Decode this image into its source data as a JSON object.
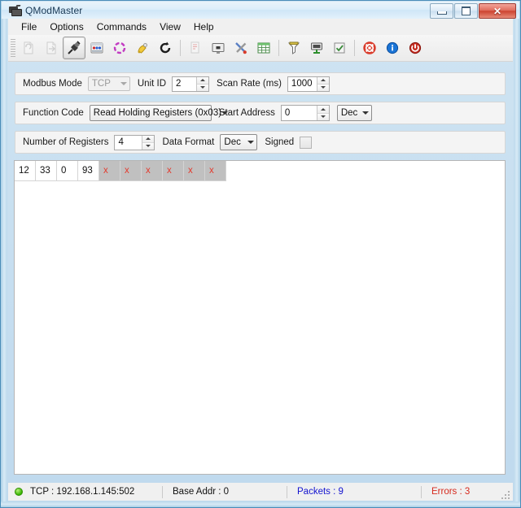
{
  "window": {
    "title": "QModMaster",
    "icon": "modbus-app-icon",
    "buttons": {
      "minimize": "minimize-button",
      "maximize": "maximize-button",
      "close": "close-button",
      "close_glyph": "✕"
    }
  },
  "menu": {
    "items": [
      {
        "label": "File"
      },
      {
        "label": "Options"
      },
      {
        "label": "Commands"
      },
      {
        "label": "View"
      },
      {
        "label": "Help"
      }
    ]
  },
  "toolbar": {
    "buttons": [
      {
        "name": "new-icon",
        "title": "New",
        "disabled": true
      },
      {
        "name": "open-icon",
        "title": "Open",
        "disabled": true
      },
      {
        "name": "connect-plug-icon",
        "title": "Connect",
        "active": true
      },
      {
        "name": "modbus-settings-icon",
        "title": "Modbus RTU/TCP Settings"
      },
      {
        "name": "scan-loop-icon",
        "title": "Scan"
      },
      {
        "name": "bell-icon",
        "title": "Alarm"
      },
      {
        "name": "reset-counters-icon",
        "title": "Reset Counters"
      },
      {
        "name": "copy-icon",
        "title": "Copy",
        "disabled": true
      },
      {
        "name": "display-icon",
        "title": "Display"
      },
      {
        "name": "tools-icon",
        "title": "Tools"
      },
      {
        "name": "table-icon",
        "title": "Table View"
      },
      {
        "name": "bus-monitor-icon",
        "title": "Bus Monitor"
      },
      {
        "name": "serial-monitor-icon",
        "title": "Serial Monitor"
      },
      {
        "name": "checklist-icon",
        "title": "Check"
      },
      {
        "name": "lifebuoy-help-icon",
        "title": "Help"
      },
      {
        "name": "info-icon",
        "title": "About"
      },
      {
        "name": "power-exit-icon",
        "title": "Exit"
      }
    ]
  },
  "mode_panel": {
    "modbus_mode_label": "Modbus Mode",
    "modbus_mode_value": "TCP",
    "unit_id_label": "Unit ID",
    "unit_id_value": "2",
    "scan_rate_label": "Scan Rate (ms)",
    "scan_rate_value": "1000"
  },
  "function_panel": {
    "function_code_label": "Function Code",
    "function_code_value": "Read Holding Registers (0x03)",
    "start_address_label": "Start Address",
    "start_address_value": "0",
    "start_address_format": "Dec"
  },
  "registers_panel": {
    "number_of_registers_label": "Number of Registers",
    "number_of_registers_value": "4",
    "data_format_label": "Data Format",
    "data_format_value": "Dec",
    "signed_label": "Signed",
    "signed_checked": false
  },
  "data_view": {
    "cells": [
      {
        "value": "12",
        "valid": true
      },
      {
        "value": "33",
        "valid": true
      },
      {
        "value": "0",
        "valid": true
      },
      {
        "value": "93",
        "valid": true
      },
      {
        "value": "x",
        "valid": false
      },
      {
        "value": "x",
        "valid": false
      },
      {
        "value": "x",
        "valid": false
      },
      {
        "value": "x",
        "valid": false
      },
      {
        "value": "x",
        "valid": false
      },
      {
        "value": "x",
        "valid": false
      }
    ]
  },
  "statusbar": {
    "connection_led": "connected-led",
    "connection": "TCP : 192.168.1.145:502",
    "base_addr": "Base Addr : 0",
    "packets": "Packets : 9",
    "errors": "Errors : 3"
  },
  "colors": {
    "accent_blue": "#1414cf",
    "error_red": "#d62a1e",
    "invalid_cell_bg": "#c0c0c0",
    "led_green": "#35b300"
  }
}
